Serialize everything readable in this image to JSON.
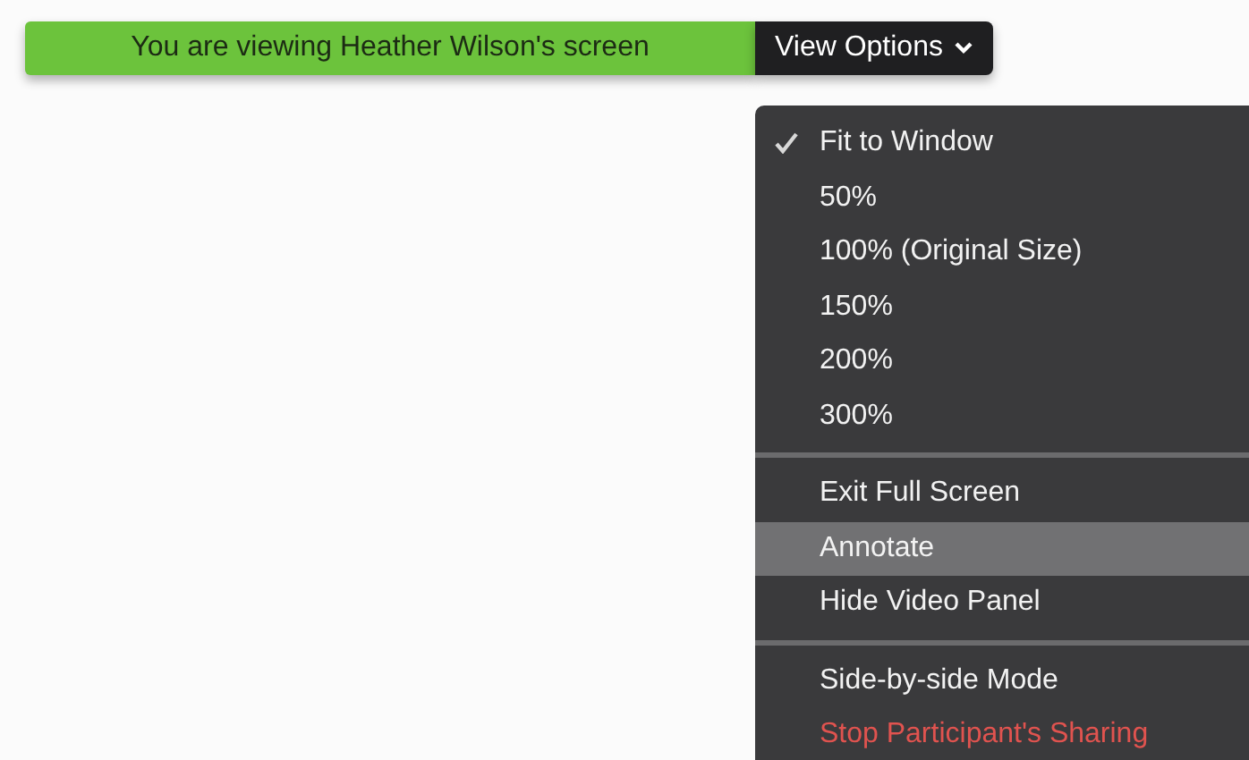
{
  "banner": {
    "message": "You are viewing Heather Wilson's screen",
    "button": "View Options"
  },
  "menu": {
    "groups": [
      {
        "items": [
          {
            "label": "Fit to Window",
            "checked": true,
            "highlighted": false,
            "kind": "normal"
          },
          {
            "label": "50%",
            "checked": false,
            "highlighted": false,
            "kind": "normal"
          },
          {
            "label": "100% (Original Size)",
            "checked": false,
            "highlighted": false,
            "kind": "normal"
          },
          {
            "label": "150%",
            "checked": false,
            "highlighted": false,
            "kind": "normal"
          },
          {
            "label": "200%",
            "checked": false,
            "highlighted": false,
            "kind": "normal"
          },
          {
            "label": "300%",
            "checked": false,
            "highlighted": false,
            "kind": "normal"
          }
        ]
      },
      {
        "items": [
          {
            "label": "Exit Full Screen",
            "checked": false,
            "highlighted": false,
            "kind": "normal"
          },
          {
            "label": "Annotate",
            "checked": false,
            "highlighted": true,
            "kind": "normal"
          },
          {
            "label": "Hide Video Panel",
            "checked": false,
            "highlighted": false,
            "kind": "normal"
          }
        ]
      },
      {
        "items": [
          {
            "label": "Side-by-side Mode",
            "checked": false,
            "highlighted": false,
            "kind": "normal"
          },
          {
            "label": "Stop Participant's Sharing",
            "checked": false,
            "highlighted": false,
            "kind": "danger"
          }
        ]
      }
    ]
  }
}
